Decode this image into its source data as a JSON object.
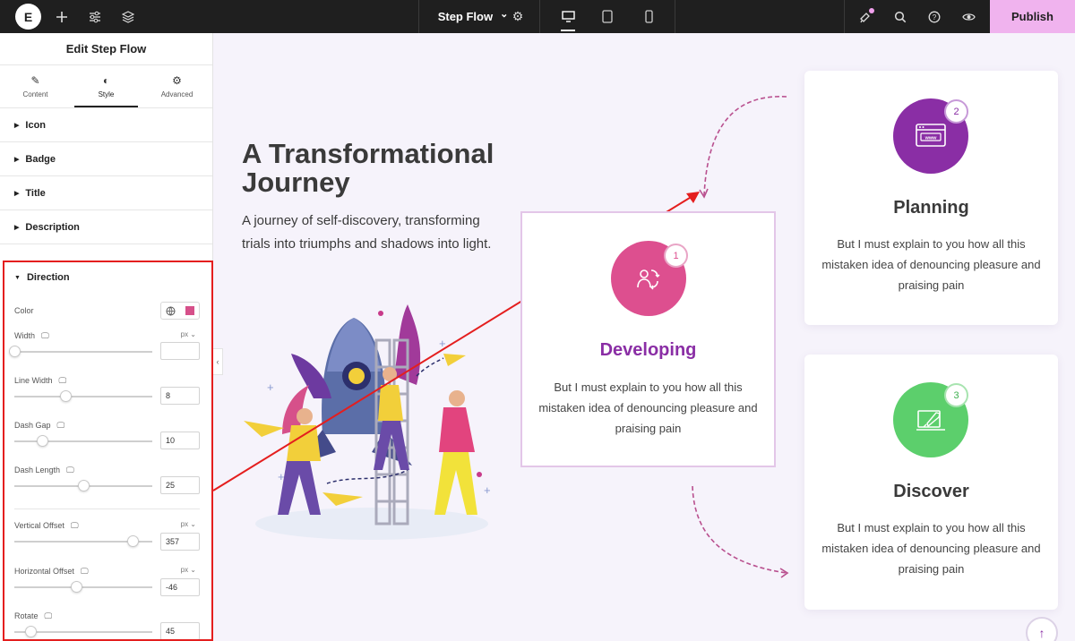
{
  "topbar": {
    "logo_text": "E",
    "add_icon": "plus-icon",
    "settings_icon": "sliders-icon",
    "layers_icon": "layers-icon",
    "document_title": "Step Flow",
    "chevron": "⌄",
    "gear": "⚙",
    "devices": [
      "desktop-icon",
      "tablet-icon",
      "mobile-icon"
    ],
    "publish_label": "Publish",
    "accent_color": "#f0b3ee"
  },
  "sidebar": {
    "title": "Edit Step Flow",
    "tabs": [
      {
        "label": "Content",
        "icon": "✎"
      },
      {
        "label": "Style",
        "icon": "◐"
      },
      {
        "label": "Advanced",
        "icon": "⚙"
      }
    ],
    "sections": [
      "Icon",
      "Badge",
      "Title",
      "Description"
    ],
    "direction": {
      "heading": "Direction",
      "color_label": "Color",
      "color_value": "#d6508a",
      "width": {
        "label": "Width",
        "unit": "px ⌄",
        "value": "",
        "slider_pct": 0
      },
      "line_width": {
        "label": "Line Width",
        "value": "8",
        "slider_pct": 37
      },
      "dash_gap": {
        "label": "Dash Gap",
        "value": "10",
        "slider_pct": 20
      },
      "dash_length": {
        "label": "Dash Length",
        "value": "25",
        "slider_pct": 50
      },
      "vertical_offset": {
        "label": "Vertical Offset",
        "unit": "px ⌄",
        "value": "357",
        "slider_pct": 86
      },
      "horizontal_offset": {
        "label": "Horizontal Offset",
        "unit": "px ⌄",
        "value": "-46",
        "slider_pct": 45
      },
      "rotate": {
        "label": "Rotate",
        "value": "45",
        "slider_pct": 12
      }
    }
  },
  "canvas": {
    "heading": "A Transformational Journey",
    "description": "A journey of self-discovery, transforming trials into triumphs and shadows into light.",
    "cards": [
      {
        "number": "1",
        "title": "Developing",
        "text": "But I must explain to you how all this mistaken idea of denouncing pleasure and praising pain",
        "color": "#dd4f8f",
        "title_color": "#8a2ea5",
        "icon": "collaboration-icon"
      },
      {
        "number": "2",
        "title": "Planning",
        "text": "But I must explain to you how all this mistaken idea of denouncing pleasure and praising pain",
        "color": "#8a2ea5",
        "title_color": "#3a3a3a",
        "icon": "web-browser-icon"
      },
      {
        "number": "3",
        "title": "Discover",
        "text": "But I must explain to you how all this mistaken idea of denouncing pleasure and praising pain",
        "color": "#5ccf6c",
        "title_color": "#3a3a3a",
        "icon": "rocket-launch-icon"
      }
    ],
    "scroll_top_icon": "↑"
  }
}
